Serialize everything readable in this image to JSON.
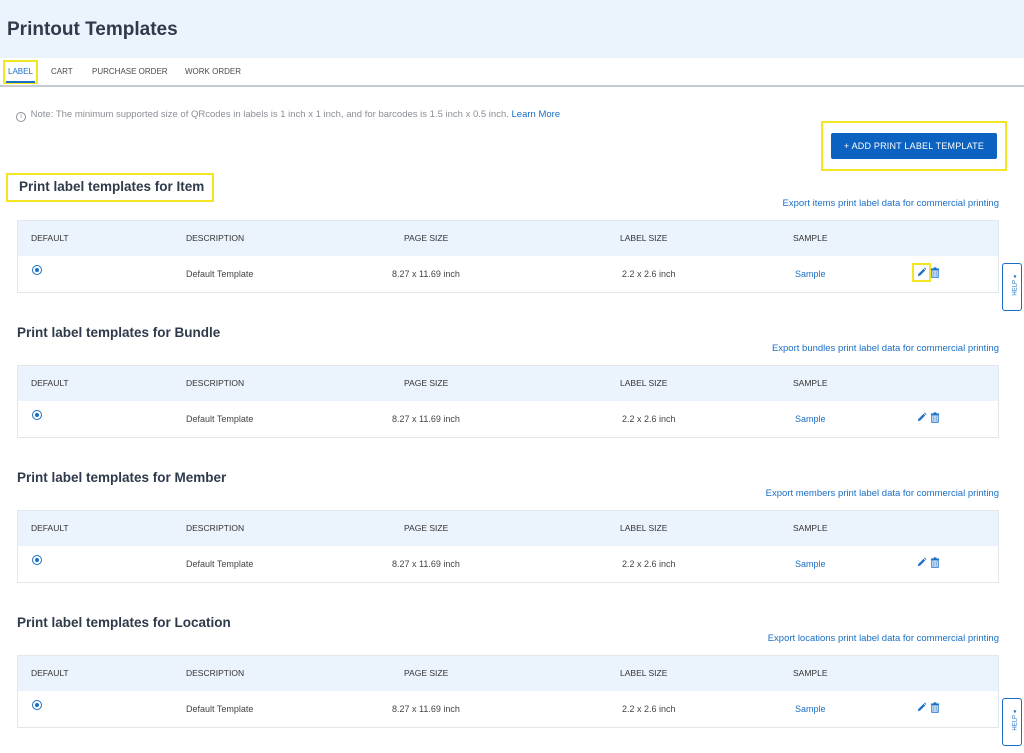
{
  "header": {
    "title": "Printout Templates"
  },
  "tabs": [
    {
      "label": "LABEL"
    },
    {
      "label": "CART"
    },
    {
      "label": "PURCHASE ORDER"
    },
    {
      "label": "WORK ORDER"
    }
  ],
  "note": {
    "icon": "info-icon",
    "text": "Note: The minimum supported size of QRcodes in labels is 1 inch x 1 inch, and for barcodes is 1.5 inch x 0.5 inch.",
    "link": "Learn More"
  },
  "add_button": {
    "label": "+ ADD PRINT LABEL TEMPLATE"
  },
  "columns": {
    "default": "DEFAULT",
    "description": "DESCRIPTION",
    "page_size": "PAGE SIZE",
    "label_size": "LABEL SIZE",
    "sample": "SAMPLE"
  },
  "sections": [
    {
      "title": "Print label templates for Item",
      "export": "Export items print label data for commercial printing",
      "row": {
        "description": "Default Template",
        "page_size": "8.27 x 11.69 inch",
        "label_size": "2.2 x 2.6 inch",
        "sample": "Sample"
      }
    },
    {
      "title": "Print label templates for Bundle",
      "export": "Export bundles print label data for commercial printing",
      "row": {
        "description": "Default Template",
        "page_size": "8.27 x 11.69 inch",
        "label_size": "2.2 x 2.6 inch",
        "sample": "Sample"
      }
    },
    {
      "title": "Print label templates for Member",
      "export": "Export members print label data for commercial printing",
      "row": {
        "description": "Default Template",
        "page_size": "8.27 x 11.69 inch",
        "label_size": "2.2 x 2.6 inch",
        "sample": "Sample"
      }
    },
    {
      "title": "Print label templates for Location",
      "export": "Export locations print label data for commercial printing",
      "row": {
        "description": "Default Template",
        "page_size": "8.27 x 11.69 inch",
        "label_size": "2.2 x 2.6 inch",
        "sample": "Sample"
      }
    }
  ],
  "help": {
    "label": "HELP ◂"
  },
  "colors": {
    "accent": "#1a6ec5",
    "button": "#0c62c1",
    "highlight": "#f3e521",
    "header_bg": "#ebf3fc"
  }
}
